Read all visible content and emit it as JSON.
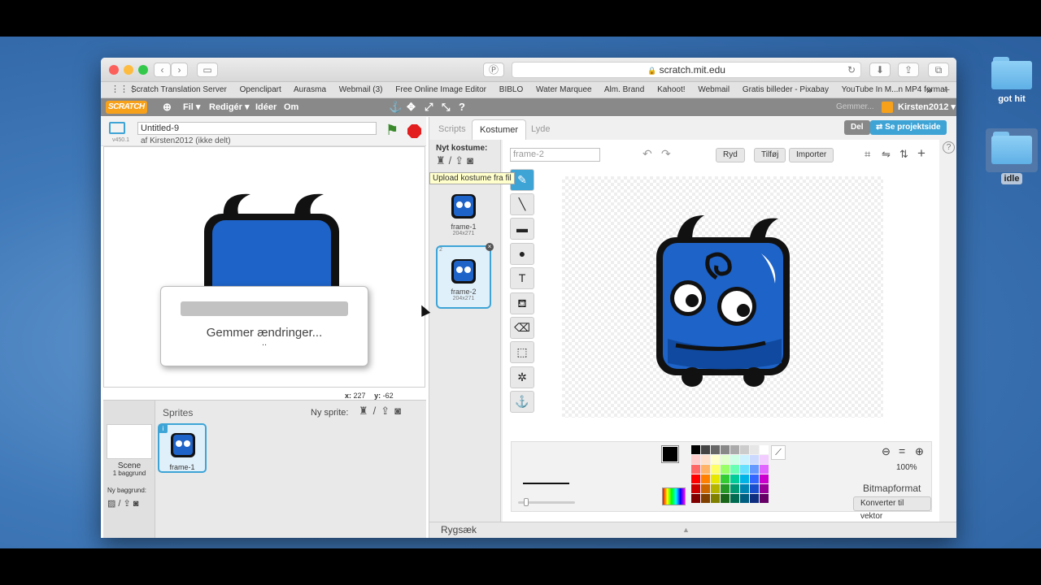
{
  "desktop": {
    "folders": [
      {
        "label": "got hit",
        "selected": false
      },
      {
        "label": "idle",
        "selected": true
      }
    ]
  },
  "browser": {
    "url": "scratch.mit.edu",
    "bookmarks": [
      "Scratch Translation Server",
      "Openclipart",
      "Aurasma",
      "Webmail (3)",
      "Free Online Image Editor",
      "BIBLO",
      "Water Marquee",
      "Alm. Brand",
      "Kahoot!",
      "Webmail",
      "Gratis billeder - Pixabay",
      "YouTube In M...n MP4 format"
    ],
    "more": "»",
    "new_tab": "+"
  },
  "scratch_menu": {
    "logo": "SCRATCH",
    "file": "Fil ▾",
    "edit": "Redigér ▾",
    "ideas": "Idéer",
    "about": "Om",
    "saving_status": "Gemmer...",
    "user": "Kirsten2012 ▾"
  },
  "project": {
    "title": "Untitled-9",
    "byline": "af Kirsten2012 (ikke delt)",
    "version": "v450.1",
    "share_button": "Del",
    "see_project_button": "Se projektside"
  },
  "stage": {
    "coords_x_label": "x:",
    "coords_x": "227",
    "coords_y_label": "y:",
    "coords_y": "-62",
    "saving_dialog": "Gemmer ændringer...",
    "saving_dots": ".."
  },
  "sprites_panel": {
    "title": "Sprites",
    "new_sprite_label": "Ny sprite:",
    "scene_label": "Scene",
    "scene_backdrops": "1 baggrund",
    "new_backdrop_label": "Ny baggrund:",
    "sprites": [
      {
        "name": "frame-1"
      }
    ]
  },
  "editor": {
    "tabs": [
      "Scripts",
      "Kostumer",
      "Lyde"
    ],
    "active_tab": "Kostumer",
    "new_costume_label": "Nyt kostume:",
    "tooltip": "Upload kostume fra fil",
    "costumes": [
      {
        "index": "",
        "name": "frame-1",
        "size": "204x271"
      },
      {
        "index": "2",
        "name": "frame-2",
        "size": "204x271"
      }
    ],
    "costume_name_value": "frame-2",
    "clear_button": "Ryd",
    "add_button": "Tilføj",
    "import_button": "Importer",
    "zoom": "100%",
    "mode_label": "Bitmapformat",
    "convert_button": "Konverter til vektor",
    "backpack": "Rygsæk",
    "colors": {
      "accent": "#3ea4d6",
      "menu_bar": "#898989",
      "monster_blue": "#1e63c8"
    }
  }
}
